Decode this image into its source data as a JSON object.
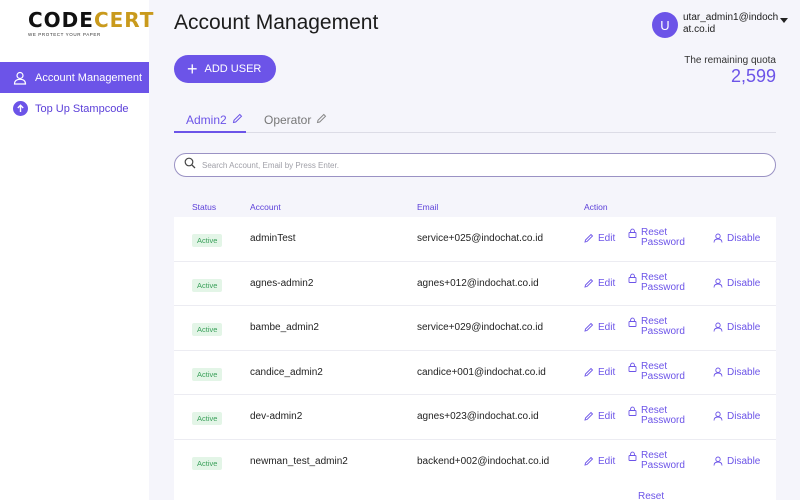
{
  "brand": {
    "logo_code": "CODE",
    "logo_cert": "CERT",
    "tagline": "WE PROTECT YOUR PAPER"
  },
  "sidebar": {
    "items": [
      {
        "label": "Account Management",
        "icon": "user-icon",
        "active": true
      },
      {
        "label": "Top Up Stampcode",
        "icon": "arrow-up-circle-icon",
        "active": false
      }
    ]
  },
  "header": {
    "title": "Account Management",
    "add_user_label": "ADD USER",
    "user": {
      "avatar_letter": "U",
      "email": "utar_admin1@indochat.co.id"
    },
    "quota_label": "The remaining quota",
    "quota_value": "2,599"
  },
  "tabs": [
    {
      "label": "Admin2",
      "active": true
    },
    {
      "label": "Operator",
      "active": false
    }
  ],
  "search": {
    "placeholder": "Search Account, Email by Press Enter."
  },
  "table": {
    "columns": {
      "status": "Status",
      "account": "Account",
      "email": "Email",
      "action": "Action"
    },
    "actions": {
      "edit": "Edit",
      "reset": "Reset Password",
      "disable": "Disable"
    },
    "rows": [
      {
        "status": "Active",
        "account": "adminTest",
        "email": "service+025@indochat.co.id"
      },
      {
        "status": "Active",
        "account": "agnes-admin2",
        "email": "agnes+012@indochat.co.id"
      },
      {
        "status": "Active",
        "account": "bambe_admin2",
        "email": "service+029@indochat.co.id"
      },
      {
        "status": "Active",
        "account": "candice_admin2",
        "email": "candice+001@indochat.co.id"
      },
      {
        "status": "Active",
        "account": "dev-admin2",
        "email": "agnes+023@indochat.co.id"
      },
      {
        "status": "Active",
        "account": "newman_test_admin2",
        "email": "backend+002@indochat.co.id"
      }
    ]
  },
  "colors": {
    "accent": "#6c54e8",
    "active_badge_bg": "#e3f5e7",
    "active_badge_text": "#3aa05a"
  }
}
